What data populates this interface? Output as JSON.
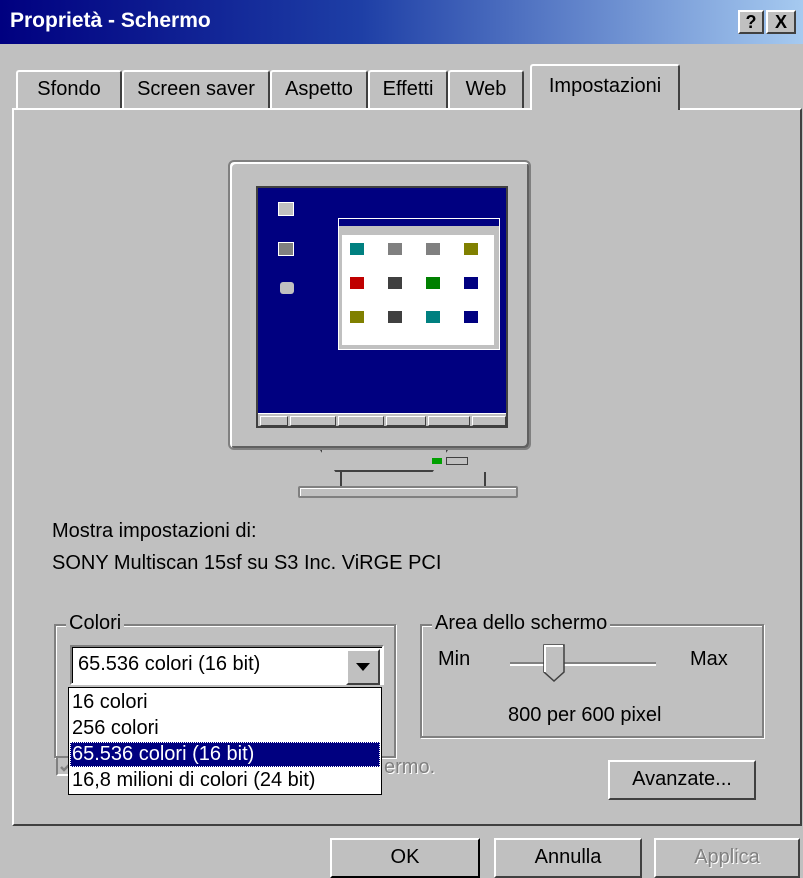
{
  "window": {
    "title": "Proprietà - Schermo",
    "help_label": "?",
    "close_label": "X"
  },
  "tabs": [
    {
      "label": "Sfondo",
      "active": false
    },
    {
      "label": "Screen saver",
      "active": false
    },
    {
      "label": "Aspetto",
      "active": false
    },
    {
      "label": "Effetti",
      "active": false
    },
    {
      "label": "Web",
      "active": false
    },
    {
      "label": "Impostazioni",
      "active": true
    }
  ],
  "display": {
    "label": "Mostra impostazioni di:",
    "device": "SONY Multiscan 15sf su S3 Inc. ViRGE PCI"
  },
  "colors": {
    "group_label": "Colori",
    "selected": "65.536 colori (16 bit)",
    "options": [
      "16 colori",
      "256 colori",
      "65.536 colori (16 bit)",
      "16,8 milioni di colori (24 bit)"
    ],
    "selected_index": 2
  },
  "screen_area": {
    "group_label": "Area dello schermo",
    "min_label": "Min",
    "max_label": "Max",
    "value_text": "800 per 600 pixel",
    "slider_position": 0.3
  },
  "checkbox": {
    "label_visible": "ermo.",
    "checked": true
  },
  "buttons": {
    "advanced": "Avanzate...",
    "ok": "OK",
    "cancel": "Annulla",
    "apply": "Applica"
  },
  "colors_palette": {
    "title_bar_start": "#000080",
    "title_bar_end": "#a6caf0",
    "face": "#c0c0c0",
    "highlight": "#000080",
    "desktop": "#000080"
  }
}
